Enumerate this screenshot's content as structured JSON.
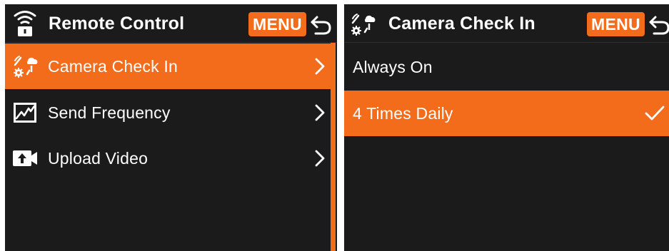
{
  "left_panel": {
    "title": "Remote Control",
    "title_icon": "wifi-lock-icon",
    "menu_label": "MENU",
    "back_icon": "back-arrow-icon",
    "items": [
      {
        "label": "Camera Check In",
        "icon": "camera-check-in-icon",
        "selected": true
      },
      {
        "label": "Send Frequency",
        "icon": "line-chart-icon",
        "selected": false
      },
      {
        "label": "Upload Video",
        "icon": "upload-video-icon",
        "selected": false
      }
    ]
  },
  "right_panel": {
    "title": "Camera Check In",
    "title_icon": "camera-check-in-icon",
    "menu_label": "MENU",
    "back_icon": "back-arrow-icon",
    "options": [
      {
        "label": "Always On",
        "selected": false
      },
      {
        "label": "4 Times Daily",
        "selected": true,
        "icon": "checkmark-icon"
      }
    ]
  },
  "colors": {
    "accent": "#f26c1c",
    "screen_background": "#1b1b1b",
    "text": "#ffffff"
  }
}
